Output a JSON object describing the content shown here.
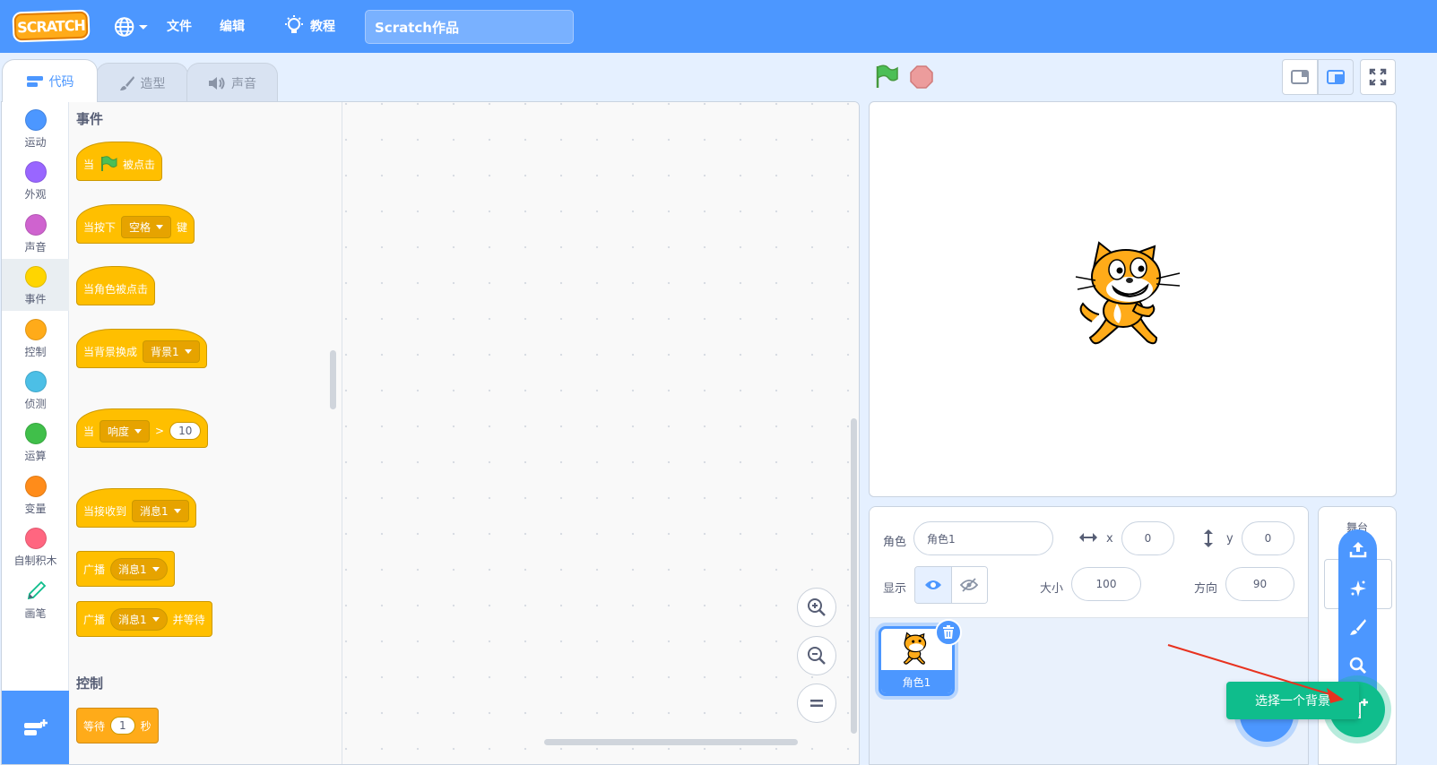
{
  "menubar": {
    "logo": "SCRATCH",
    "file": "文件",
    "edit": "编辑",
    "tutorials": "教程",
    "project_title": "Scratch作品"
  },
  "tabs": {
    "code": "代码",
    "costumes": "造型",
    "sounds": "声音"
  },
  "categories": [
    {
      "label": "运动",
      "color": "#4c97ff"
    },
    {
      "label": "外观",
      "color": "#9966ff"
    },
    {
      "label": "声音",
      "color": "#cf63cf"
    },
    {
      "label": "事件",
      "color": "#ffd500"
    },
    {
      "label": "控制",
      "color": "#ffab19"
    },
    {
      "label": "侦测",
      "color": "#4cbfe6"
    },
    {
      "label": "运算",
      "color": "#40bf4a"
    },
    {
      "label": "变量",
      "color": "#ff8c1a"
    },
    {
      "label": "自制积木",
      "color": "#ff6680"
    },
    {
      "label": "画笔",
      "color": "#0fbd8c"
    }
  ],
  "palette": {
    "events_heading": "事件",
    "when_flag_a": "当",
    "when_flag_b": "被点击",
    "when_key": "当按下",
    "key_value": "空格",
    "key_suffix": "键",
    "when_sprite_clicked": "当角色被点击",
    "when_backdrop": "当背景换成",
    "backdrop_value": "背景1",
    "when_loud": "当",
    "loud_value": "响度",
    "gt": ">",
    "loud_num": "10",
    "when_receive": "当接收到",
    "msg_value": "消息1",
    "broadcast": "广播",
    "broadcast_msg": "消息1",
    "broadcast_wait": "广播",
    "broadcast_wait_msg": "消息1",
    "broadcast_wait_suffix": "并等待",
    "control_heading": "控制",
    "wait": "等待",
    "wait_num": "1",
    "wait_suffix": "秒"
  },
  "sprite_info": {
    "sprite_label": "角色",
    "sprite_name": "角色1",
    "x_label": "x",
    "x_value": "0",
    "y_label": "y",
    "y_value": "0",
    "show_label": "显示",
    "size_label": "大小",
    "size_value": "100",
    "direction_label": "方向",
    "direction_value": "90"
  },
  "sprites": [
    {
      "name": "角色1"
    }
  ],
  "stage_pane": {
    "heading": "舞台"
  },
  "tooltip": "选择一个背景",
  "colors": {
    "menubar": "#4c97ff",
    "events": "#ffbf00",
    "control": "#ffab19",
    "backdrop_button": "#0fbd8c",
    "annotation_arrow": "#e8321f"
  }
}
